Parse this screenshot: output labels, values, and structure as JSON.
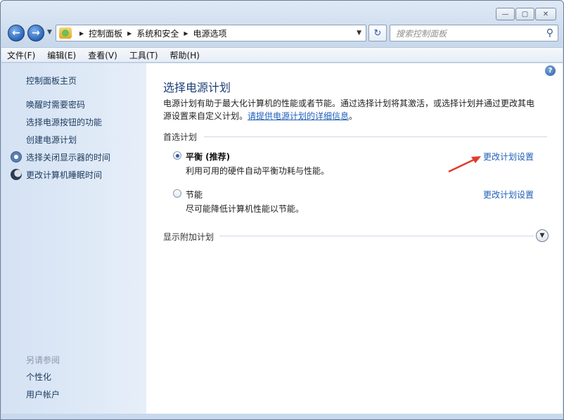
{
  "window": {
    "caption": {
      "minimize": "—",
      "maximize": "▢",
      "close": "✕"
    }
  },
  "address_bar": {
    "crumbs": [
      "控制面板",
      "系统和安全",
      "电源选项"
    ],
    "search_placeholder": "搜索控制面板"
  },
  "menu": [
    "文件(F)",
    "编辑(E)",
    "查看(V)",
    "工具(T)",
    "帮助(H)"
  ],
  "sidebar": {
    "home": "控制面板主页",
    "items": [
      {
        "label": "唤醒时需要密码",
        "icon": ""
      },
      {
        "label": "选择电源按钮的功能",
        "icon": ""
      },
      {
        "label": "创建电源计划",
        "icon": ""
      },
      {
        "label": "选择关闭显示器的时间",
        "icon": "display-clock-icon"
      },
      {
        "label": "更改计算机睡眠时间",
        "icon": "moon-icon"
      }
    ],
    "see_also": "另请参阅",
    "see_also_items": [
      "个性化",
      "用户帐户"
    ]
  },
  "main": {
    "title": "选择电源计划",
    "intro_line1": "电源计划有助于最大化计算机的性能或者节能。通过选择计划将其激活，或选择计划并通过更改其电",
    "intro_line2_prefix": "源设置来自定义计划。",
    "intro_link": "请提供电源计划的详细信息",
    "intro_suffix": "。",
    "preferred_header": "首选计划",
    "plans": [
      {
        "name": "平衡 (推荐)",
        "desc": "利用可用的硬件自动平衡功耗与性能。",
        "link": "更改计划设置",
        "selected": true
      },
      {
        "name": "节能",
        "desc": "尽可能降低计算机性能以节能。",
        "link": "更改计划设置",
        "selected": false
      }
    ],
    "show_more": "显示附加计划"
  },
  "colors": {
    "accent": "#1f5fb9",
    "title": "#1e3e78",
    "annotation_arrow": "#e23a2a"
  }
}
